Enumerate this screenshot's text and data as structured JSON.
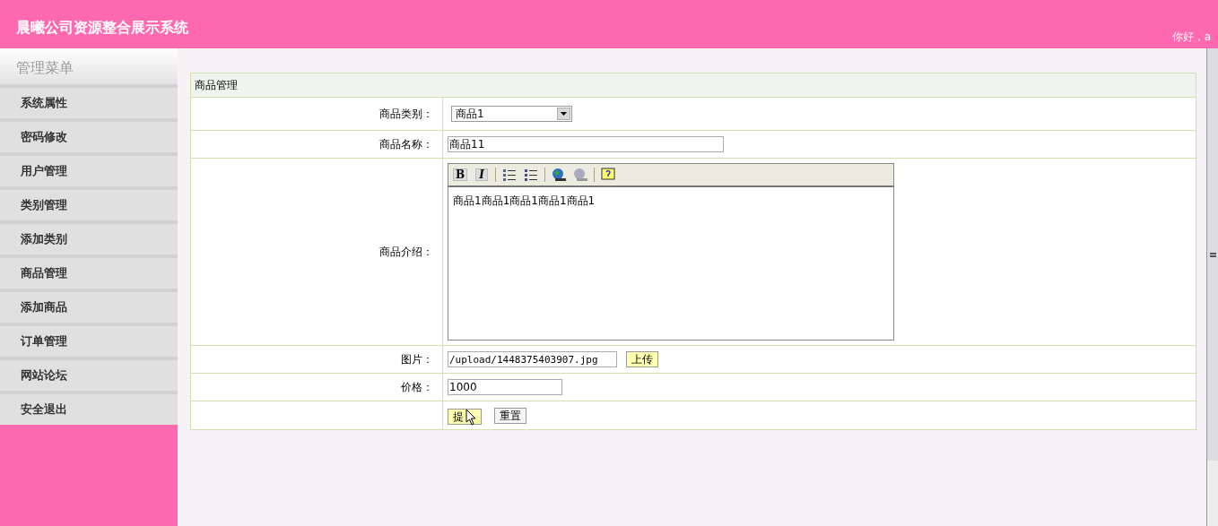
{
  "header": {
    "title": "晨曦公司资源整合展示系统",
    "greeting": "你好，a"
  },
  "sidebar": {
    "title": "管理菜单",
    "items": [
      {
        "label": "系统属性"
      },
      {
        "label": "密码修改"
      },
      {
        "label": "用户管理"
      },
      {
        "label": "类别管理"
      },
      {
        "label": "添加类别"
      },
      {
        "label": "商品管理"
      },
      {
        "label": "添加商品"
      },
      {
        "label": "订单管理"
      },
      {
        "label": "网站论坛"
      },
      {
        "label": "安全退出"
      }
    ]
  },
  "form": {
    "title": "商品管理",
    "rows": [
      {
        "kind": "select",
        "label": "商品类别：",
        "value": "商品1"
      },
      {
        "kind": "text",
        "label": "商品名称：",
        "value": "商品11"
      },
      {
        "kind": "editor",
        "label": "商品介绍：",
        "value": "商品1商品1商品1商品1商品1",
        "bold_glyph": "B",
        "italic_glyph": "I"
      },
      {
        "kind": "upload",
        "label": "图片：",
        "value": "/upload/1448375403907.jpg",
        "button": "上传"
      },
      {
        "kind": "price",
        "label": "价格：",
        "value": "1000"
      },
      {
        "kind": "buttons",
        "submit": "提",
        "reset": "重置"
      }
    ]
  }
}
